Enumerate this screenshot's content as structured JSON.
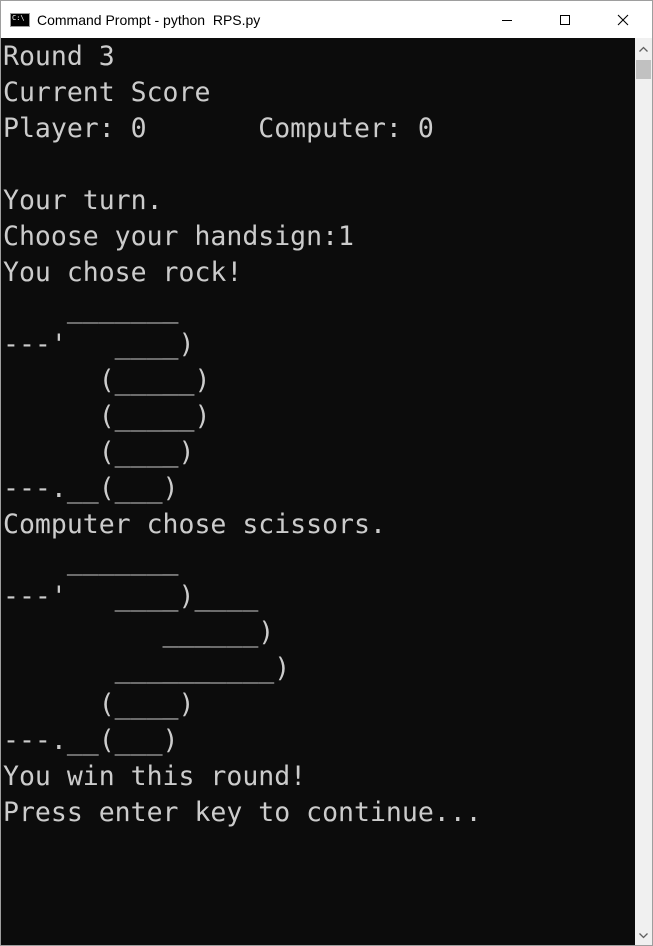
{
  "window": {
    "title": "Command Prompt - python  RPS.py",
    "icon": "cmd-icon",
    "controls": {
      "minimize_icon": "minimize-icon",
      "maximize_icon": "maximize-icon",
      "close_icon": "close-icon"
    }
  },
  "console": {
    "lines": [
      "Round 3",
      "Current Score",
      "Player: 0       Computer: 0",
      "",
      "Your turn.",
      "Choose your handsign:1",
      "You chose rock!",
      "    _______",
      "---'   ____)",
      "      (_____)",
      "      (_____)",
      "      (____)",
      "---.__(___)",
      "Computer chose scissors.",
      "    _______",
      "---'   ____)____",
      "          ______)",
      "       __________)",
      "      (____)",
      "---.__(___)",
      "You win this round!",
      "Press enter key to continue..."
    ]
  },
  "colors": {
    "terminal_bg": "#0c0c0c",
    "terminal_fg": "#cccccc",
    "titlebar_bg": "#ffffff",
    "scrollbar_bg": "#f0f0f0",
    "scrollbar_thumb": "#c1c1c1"
  }
}
